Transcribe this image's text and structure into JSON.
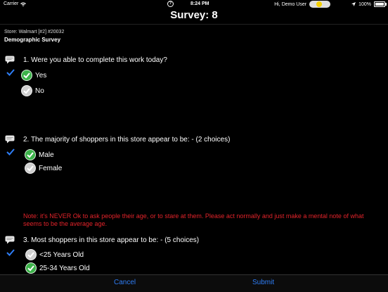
{
  "status": {
    "carrier": "Carrier",
    "time": "8:24 PM",
    "user": "Hi, Demo User",
    "battery": "100%"
  },
  "nav": {
    "title": "Survey: 8"
  },
  "store_line": "Store: Walmart [#2] #20032",
  "survey_name": "Demographic Survey",
  "questions": [
    {
      "text": "1. Were you able to complete this work today?",
      "options": [
        {
          "label": "Yes",
          "selected": true
        },
        {
          "label": "No",
          "selected": false
        }
      ]
    },
    {
      "text": "2. The majority of shoppers in this store appear to be: - (2 choices)",
      "options": [
        {
          "label": "Male",
          "selected": true
        },
        {
          "label": "Female",
          "selected": false
        }
      ]
    },
    {
      "text": "3. Most shoppers in this store appear to be: - (5 choices)",
      "options": [
        {
          "label": "<25 Years Old",
          "selected": false
        },
        {
          "label": "25-34 Years Old",
          "selected": true
        }
      ]
    }
  ],
  "note": "Note: it's NEVER Ok to ask people their age, or to stare at them. Please act normally and just make a mental note of what seems to be the average age.",
  "toolbar": {
    "cancel": "Cancel",
    "submit": "Submit"
  },
  "colors": {
    "accent": "#2e7df6",
    "note": "#e2232a",
    "selected": "#3cb34a",
    "unselected": "#cfcfcf",
    "check": "#2e7df6"
  }
}
